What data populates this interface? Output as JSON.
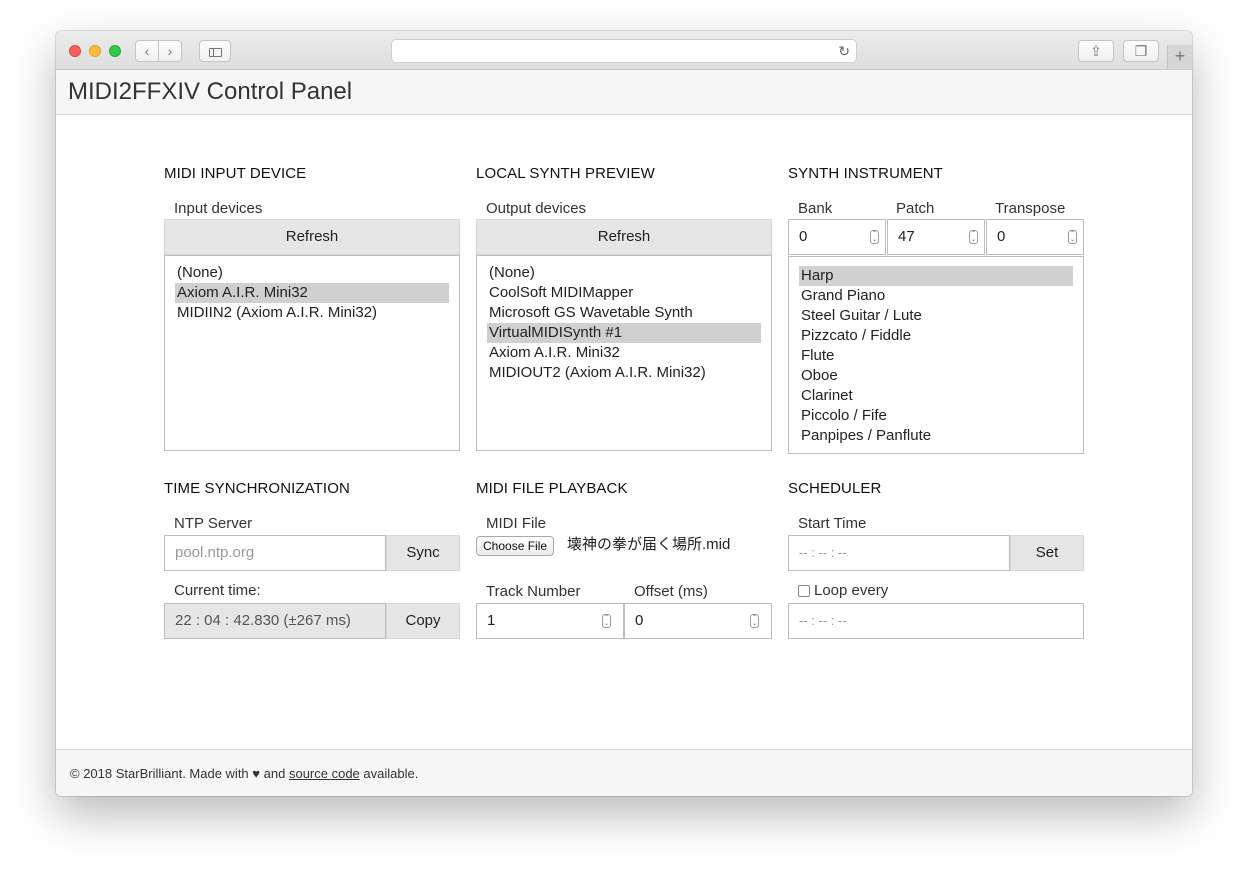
{
  "app": {
    "title": "MIDI2FFXIV Control Panel"
  },
  "browser": {
    "back_icon": "‹",
    "forward_icon": "›",
    "reload_icon": "↻",
    "share_icon": "⇪",
    "tabs_icon": "❐",
    "new_tab_icon": "+"
  },
  "midi_input": {
    "section_title": "MIDI INPUT DEVICE",
    "label": "Input devices",
    "refresh_label": "Refresh",
    "devices": [
      "(None)",
      "Axiom A.I.R. Mini32",
      "MIDIIN2 (Axiom A.I.R. Mini32)"
    ],
    "selected": "Axiom A.I.R. Mini32"
  },
  "local_synth": {
    "section_title": "LOCAL SYNTH PREVIEW",
    "label": "Output devices",
    "refresh_label": "Refresh",
    "devices": [
      "(None)",
      "CoolSoft MIDIMapper",
      "Microsoft GS Wavetable Synth",
      "VirtualMIDISynth #1",
      "Axiom A.I.R. Mini32",
      "MIDIOUT2 (Axiom A.I.R. Mini32)"
    ],
    "selected": "VirtualMIDISynth #1"
  },
  "synth_instrument": {
    "section_title": "SYNTH INSTRUMENT",
    "bank_label": "Bank",
    "bank_value": "0",
    "patch_label": "Patch",
    "patch_value": "47",
    "transpose_label": "Transpose",
    "transpose_value": "0",
    "instruments": [
      "Harp",
      "Grand Piano",
      "Steel Guitar / Lute",
      "Pizzcato / Fiddle",
      "Flute",
      "Oboe",
      "Clarinet",
      "Piccolo / Fife",
      "Panpipes / Panflute"
    ],
    "selected": "Harp"
  },
  "time_sync": {
    "section_title": "TIME SYNCHRONIZATION",
    "ntp_label": "NTP Server",
    "ntp_placeholder": "pool.ntp.org",
    "sync_label": "Sync",
    "current_time_label": "Current time:",
    "current_time_value": "22 : 04 : 42.830 (±267 ms)",
    "copy_label": "Copy"
  },
  "midi_file": {
    "section_title": "MIDI FILE PLAYBACK",
    "file_label": "MIDI File",
    "choose_file_label": "Choose File",
    "file_name": "壊神の拳が届く場所.mid",
    "track_label": "Track Number",
    "track_value": "1",
    "offset_label": "Offset (ms)",
    "offset_value": "0"
  },
  "scheduler": {
    "section_title": "SCHEDULER",
    "start_time_label": "Start Time",
    "start_time_placeholder": "-- : -- : --",
    "set_label": "Set",
    "loop_label": "Loop every",
    "loop_placeholder": "-- : -- : --"
  },
  "footer": {
    "prefix": "© 2018 StarBrilliant. Made with",
    "heart": "♥",
    "middle": "and",
    "link": "source code",
    "suffix": "available."
  }
}
